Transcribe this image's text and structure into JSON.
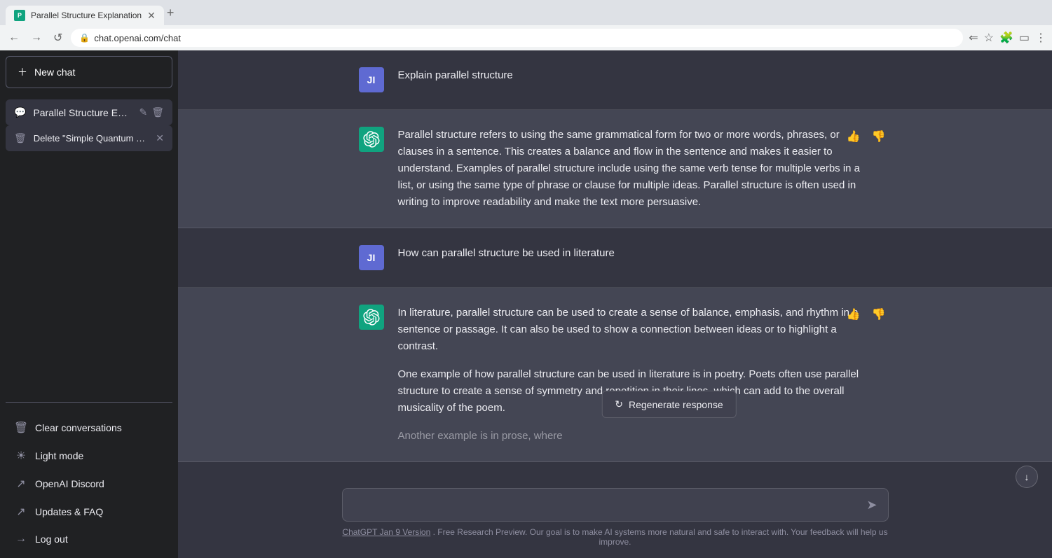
{
  "browser": {
    "tab_title": "Parallel Structure Explanation",
    "tab_favicon": "P",
    "url": "chat.openai.com/chat",
    "new_tab_label": "+"
  },
  "sidebar": {
    "new_chat_label": "New chat",
    "conversations": [
      {
        "id": "parallel",
        "title": "Parallel Structure Expla",
        "active": true
      }
    ],
    "delete_item": "Delete \"Simple Quantum Com\"",
    "bottom_actions": [
      {
        "id": "clear",
        "label": "Clear conversations",
        "icon": "🗑"
      },
      {
        "id": "light",
        "label": "Light mode",
        "icon": "☀"
      },
      {
        "id": "discord",
        "label": "OpenAI Discord",
        "icon": "↗"
      },
      {
        "id": "faq",
        "label": "Updates & FAQ",
        "icon": "↗"
      },
      {
        "id": "logout",
        "label": "Log out",
        "icon": "→"
      }
    ]
  },
  "chat": {
    "messages": [
      {
        "id": "user1",
        "role": "user",
        "avatar_initials": "JI",
        "text": "Explain parallel structure"
      },
      {
        "id": "ai1",
        "role": "ai",
        "text_paragraphs": [
          "Parallel structure refers to using the same grammatical form for two or more words, phrases, or clauses in a sentence. This creates a balance and flow in the sentence and makes it easier to understand. Examples of parallel structure include using the same verb tense for multiple verbs in a list, or using the same type of phrase or clause for multiple ideas. Parallel structure is often used in writing to improve readability and make the text more persuasive."
        ]
      },
      {
        "id": "user2",
        "role": "user",
        "avatar_initials": "JI",
        "text": "How can parallel structure be used in literature"
      },
      {
        "id": "ai2",
        "role": "ai",
        "text_paragraphs": [
          "In literature, parallel structure can be used to create a sense of balance, emphasis, and rhythm in a sentence or passage. It can also be used to show a connection between ideas or to highlight a contrast.",
          "One example of how parallel structure can be used in literature is in poetry. Poets often use parallel structure to create a sense of symmetry and repetition in their lines, which can add to the overall musicality of the poem.",
          "Another example is in prose, where"
        ],
        "last_paragraph_truncated": true
      }
    ],
    "input_placeholder": "",
    "regenerate_label": "Regenerate response",
    "footer_link_text": "ChatGPT Jan 9 Version",
    "footer_text": ". Free Research Preview. Our goal is to make AI systems more natural and safe to interact with. Your feedback will help us improve."
  }
}
